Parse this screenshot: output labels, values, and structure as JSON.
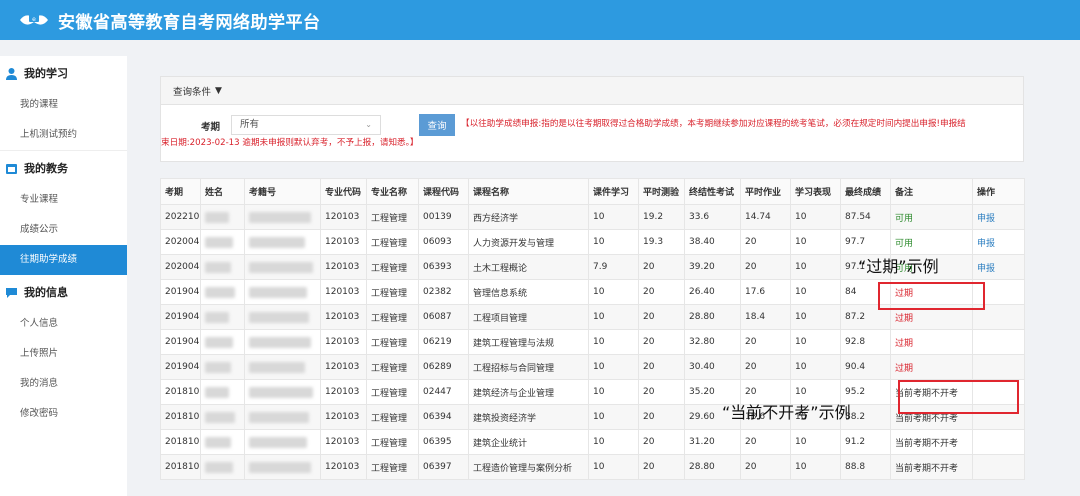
{
  "header": {
    "title": "安徽省高等教育自考网络助学平台"
  },
  "sidebar": {
    "groups": [
      {
        "label": "我的学习",
        "icon": "user-icon",
        "items": [
          "我的课程",
          "上机测试预约"
        ]
      },
      {
        "label": "我的教务",
        "icon": "calendar-icon",
        "items": [
          "专业课程",
          "成绩公示",
          "往期助学成绩"
        ]
      },
      {
        "label": "我的信息",
        "icon": "chat-icon",
        "items": [
          "个人信息",
          "上传照片",
          "我的消息",
          "修改密码"
        ]
      }
    ],
    "active": "往期助学成绩"
  },
  "query": {
    "title": "查询条件",
    "term_label": "考期",
    "term_value": "所有",
    "search_label": "查询",
    "notice_line1": "【以往助学成绩申报:指的是以往考期取得过合格助学成绩，本考期继续参加对应课程的统考笔试，必须在规定时间内提出申报!申报结",
    "notice_line2": "束日期:2023-02-13 逾期未申报则默认弃考，不予上报，请知悉。】"
  },
  "table": {
    "headers": [
      "考期",
      "姓名",
      "考籍号",
      "专业代码",
      "专业名称",
      "课程代码",
      "课程名称",
      "课件学习",
      "平时测验",
      "终结性考试",
      "平时作业",
      "学习表现",
      "最终成绩",
      "备注",
      "操作"
    ],
    "rows": [
      [
        "202210",
        "",
        "",
        "120103",
        "工程管理",
        "00139",
        "西方经济学",
        "10",
        "19.2",
        "33.6",
        "14.74",
        "10",
        "87.54",
        "可用",
        "申报"
      ],
      [
        "202004",
        "",
        "",
        "120103",
        "工程管理",
        "06093",
        "人力资源开发与管理",
        "10",
        "19.3",
        "38.40",
        "20",
        "10",
        "97.7",
        "可用",
        "申报"
      ],
      [
        "202004",
        "",
        "",
        "120103",
        "工程管理",
        "06393",
        "土木工程概论",
        "7.9",
        "20",
        "39.20",
        "20",
        "10",
        "97.1",
        "可用",
        "申报"
      ],
      [
        "201904",
        "",
        "",
        "120103",
        "工程管理",
        "02382",
        "管理信息系统",
        "10",
        "20",
        "26.40",
        "17.6",
        "10",
        "84",
        "过期",
        ""
      ],
      [
        "201904",
        "",
        "",
        "120103",
        "工程管理",
        "06087",
        "工程项目管理",
        "10",
        "20",
        "28.80",
        "18.4",
        "10",
        "87.2",
        "过期",
        ""
      ],
      [
        "201904",
        "",
        "",
        "120103",
        "工程管理",
        "06219",
        "建筑工程管理与法规",
        "10",
        "20",
        "32.80",
        "20",
        "10",
        "92.8",
        "过期",
        ""
      ],
      [
        "201904",
        "",
        "",
        "120103",
        "工程管理",
        "06289",
        "工程招标与合同管理",
        "10",
        "20",
        "30.40",
        "20",
        "10",
        "90.4",
        "过期",
        ""
      ],
      [
        "201810",
        "",
        "",
        "120103",
        "工程管理",
        "02447",
        "建筑经济与企业管理",
        "10",
        "20",
        "35.20",
        "20",
        "10",
        "95.2",
        "当前考期不开考",
        ""
      ],
      [
        "201810",
        "",
        "",
        "120103",
        "工程管理",
        "06394",
        "建筑投资经济学",
        "10",
        "20",
        "29.60",
        "18.6",
        "10",
        "88.2",
        "当前考期不开考",
        ""
      ],
      [
        "201810",
        "",
        "",
        "120103",
        "工程管理",
        "06395",
        "建筑企业统计",
        "10",
        "20",
        "31.20",
        "20",
        "10",
        "91.2",
        "当前考期不开考",
        ""
      ],
      [
        "201810",
        "",
        "",
        "120103",
        "工程管理",
        "06397",
        "工程造价管理与案例分析",
        "10",
        "20",
        "28.80",
        "20",
        "10",
        "88.8",
        "当前考期不开考",
        ""
      ]
    ]
  },
  "annotations": {
    "expired_label": "“过期”示例",
    "not_open_label": "“当前不开考”示例"
  },
  "colors": {
    "header": "#2d9ae0",
    "active": "#1f8ad6",
    "ok": "#2e8b2e",
    "expired": "#d9232d",
    "annotation": "#e0262f"
  }
}
